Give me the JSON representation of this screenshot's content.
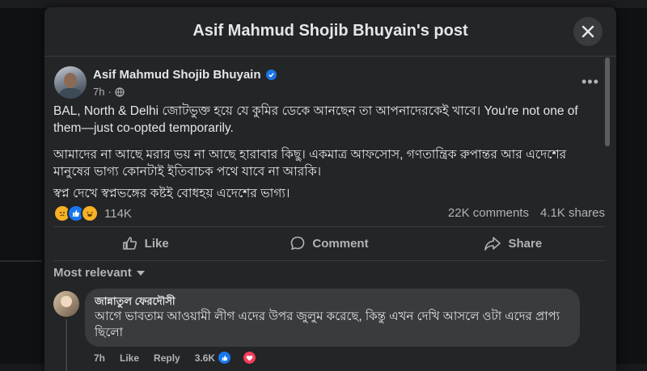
{
  "modal": {
    "title": "Asif Mahmud Shojib Bhuyain's post"
  },
  "post": {
    "author": "Asif Mahmud Shojib Bhuyain",
    "time": "7h",
    "privacy_icon": "globe-icon",
    "paragraphs": [
      "BAL, North & Delhi জোটভুক্ত হয়ে যে কুমির ডেকে আনছেন তা আপনাদেরকেই খাবে। You're not one of them—just co-opted temporarily.",
      "আমাদের না আছে মরার ভয় না আছে হারাবার কিছু। একমাত্র আফসোস, গণতান্ত্রিক রুপান্তর আর এদেশের মানুষের ভাগ্য কোনটাই ইতিবাচক পথে যাবে না আরকি।",
      "স্বপ্ন দেখে স্বপ্নভঙ্গের কষ্টই বোধহয় এদেশের ভাগ্য।"
    ],
    "reaction_count": "114K",
    "comments_count": "22K comments",
    "shares_count": "4.1K shares",
    "reactions": [
      "sad",
      "like",
      "haha"
    ]
  },
  "actions": {
    "like": "Like",
    "comment": "Comment",
    "share": "Share"
  },
  "sort": {
    "label": "Most relevant"
  },
  "comment": {
    "name": "জান্নাতুল ফেরদৌসী",
    "text": "আগে ভাবতাম আওয়ামী লীগ এদের উপর জুলুম করেছে, কিন্তু এখন দেখি আসলে ওটা এদের প্রাপ্য ছিলো",
    "time": "7h",
    "like": "Like",
    "reply": "Reply",
    "reaction_count": "3.6K"
  },
  "colors": {
    "accent": "#1b74e4",
    "modal_bg": "#242526",
    "bubble_bg": "#3a3b3c",
    "text_primary": "#e4e6eb",
    "text_secondary": "#b0b3b8"
  }
}
